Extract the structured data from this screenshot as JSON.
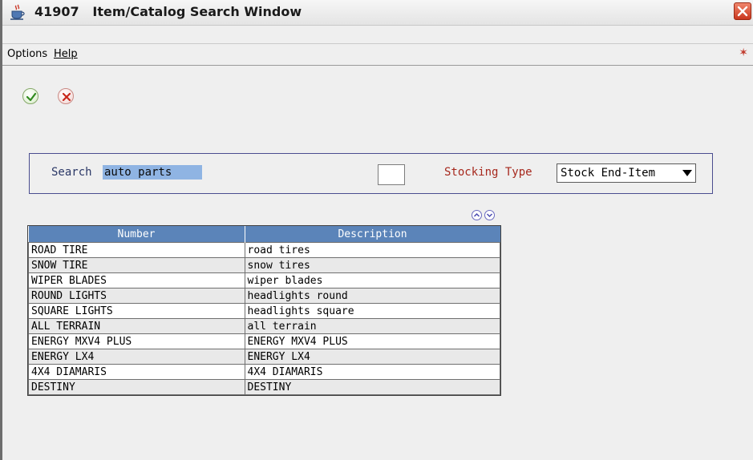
{
  "window": {
    "number": "41907",
    "title": "Item/Catalog Search Window"
  },
  "menu": {
    "options": "Options",
    "help": "Help"
  },
  "toolbar": {
    "ok_icon": "checkmark-icon",
    "cancel_icon": "cancel-x-icon"
  },
  "search": {
    "label": "Search",
    "value": "auto parts"
  },
  "stocking": {
    "label": "Stocking Type",
    "value": "Stock End-Item"
  },
  "grid": {
    "columns": [
      "Number",
      "Description"
    ],
    "rows": [
      [
        "ROAD TIRE",
        "road tires"
      ],
      [
        "SNOW TIRE",
        "snow tires"
      ],
      [
        "WIPER BLADES",
        "wiper blades"
      ],
      [
        "ROUND LIGHTS",
        "headlights round"
      ],
      [
        "SQUARE LIGHTS",
        "headlights square"
      ],
      [
        "ALL TERRAIN",
        "all terrain"
      ],
      [
        "ENERGY MXV4 PLUS",
        "ENERGY MXV4 PLUS"
      ],
      [
        "ENERGY LX4",
        "ENERGY LX4"
      ],
      [
        "4X4 DIAMARIS",
        "4X4 DIAMARIS"
      ],
      [
        "DESTINY",
        "DESTINY"
      ]
    ]
  },
  "colors": {
    "header_blue": "#5b84b9",
    "search_highlight": "#8fb4e3",
    "stock_label_red": "#a6281d"
  }
}
